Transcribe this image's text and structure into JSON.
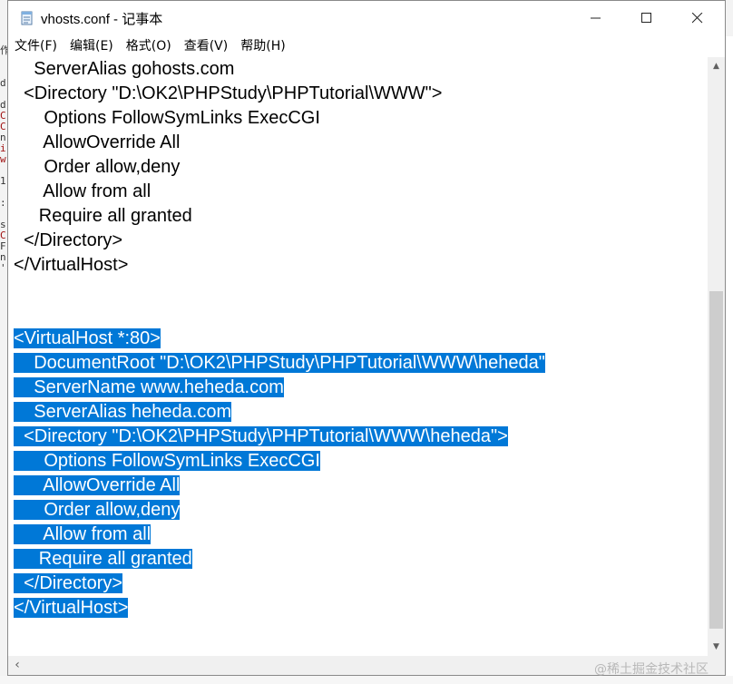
{
  "window": {
    "title": "vhosts.conf - 记事本",
    "minimize": "—",
    "maximize": "☐",
    "close": "✕"
  },
  "menu": [
    "文件(F)",
    "编辑(E)",
    "格式(O)",
    "查看(V)",
    "帮助(H)"
  ],
  "editor": {
    "lines": [
      {
        "text": "    ServerAlias gohosts.com",
        "selected": false
      },
      {
        "text": "  <Directory \"D:\\OK2\\PHPStudy\\PHPTutorial\\WWW\">",
        "selected": false
      },
      {
        "text": "      Options FollowSymLinks ExecCGI",
        "selected": false
      },
      {
        "text": "      AllowOverride All",
        "selected": false
      },
      {
        "text": "      Order allow,deny",
        "selected": false
      },
      {
        "text": "      Allow from all",
        "selected": false
      },
      {
        "text": "     Require all granted",
        "selected": false
      },
      {
        "text": "  </Directory>",
        "selected": false
      },
      {
        "text": "</VirtualHost>",
        "selected": false
      },
      {
        "text": "",
        "selected": false
      },
      {
        "text": "",
        "selected": false
      },
      {
        "text": "<VirtualHost *:80>",
        "selected": true
      },
      {
        "text": "    DocumentRoot \"D:\\OK2\\PHPStudy\\PHPTutorial\\WWW\\heheda\"",
        "selected": true
      },
      {
        "text": "    ServerName www.heheda.com",
        "selected": true
      },
      {
        "text": "    ServerAlias heheda.com",
        "selected": true
      },
      {
        "text": "  <Directory \"D:\\OK2\\PHPStudy\\PHPTutorial\\WWW\\heheda\">",
        "selected": true
      },
      {
        "text": "      Options FollowSymLinks ExecCGI",
        "selected": true
      },
      {
        "text": "      AllowOverride All",
        "selected": true
      },
      {
        "text": "      Order allow,deny",
        "selected": true
      },
      {
        "text": "      Allow from all",
        "selected": true
      },
      {
        "text": "     Require all granted",
        "selected": true
      },
      {
        "text": "  </Directory>",
        "selected": true
      },
      {
        "text": "</VirtualHost>",
        "selected": true
      }
    ]
  },
  "scrollbar": {
    "vertical_position": 0.62,
    "up_arrow": "▲",
    "down_arrow": "▼",
    "left_arrow": "‹"
  },
  "watermark": "@稀土掘金技术社区",
  "background_strip": [
    "作",
    "",
    "",
    "d",
    "",
    "d",
    "C",
    "C",
    "n",
    "i",
    "w",
    "",
    "1",
    "",
    ":",
    "",
    "s",
    "C",
    "F",
    "n",
    "'",
    ""
  ]
}
